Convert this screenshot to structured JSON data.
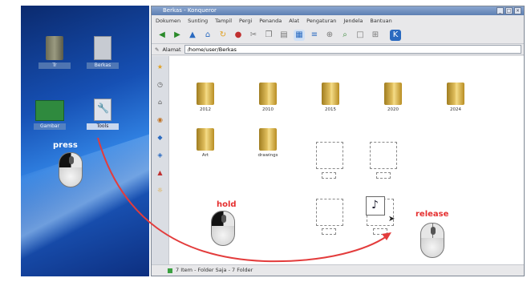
{
  "annotations": {
    "press": "press",
    "hold": "hold",
    "release": "release"
  },
  "window": {
    "title": "Berkas - Konqueror",
    "menu": [
      "Dokumen",
      "Sunting",
      "Tampil",
      "Pergi",
      "Penanda",
      "Alat",
      "Pengaturan",
      "Jendela",
      "Bantuan"
    ],
    "toolbar_icons": [
      "back-icon",
      "forward-icon",
      "up-icon",
      "home-icon",
      "reload-icon",
      "stop-icon",
      "cut-icon",
      "copy-icon",
      "paste-icon",
      "view-icon",
      "zoom-icon",
      "find-icon",
      "icon-view-icon",
      "detail-view-icon",
      "konqueror-icon"
    ],
    "location_label": "Alamat",
    "location_value": "/home/user/Berkas",
    "files": [
      {
        "name": "2012"
      },
      {
        "name": "2010"
      },
      {
        "name": "2015"
      },
      {
        "name": "2020"
      },
      {
        "name": "2024"
      },
      {
        "name": "Art"
      },
      {
        "name": "drawings"
      }
    ],
    "status": "7 Item - Folder Saja - 7 Folder"
  },
  "desktop": {
    "icons": [
      {
        "name": "Tr",
        "type": "folder"
      },
      {
        "name": "Berkas",
        "type": "document"
      },
      {
        "name": "Gambar",
        "type": "green"
      },
      {
        "name": "Tools",
        "type": "wrench"
      }
    ]
  },
  "colors": {
    "annotation_red": "#e53030",
    "arrow_red": "#e33c3c",
    "desktop_blue": "#1650b4",
    "titlebar_blue": "#5d7fb3"
  }
}
